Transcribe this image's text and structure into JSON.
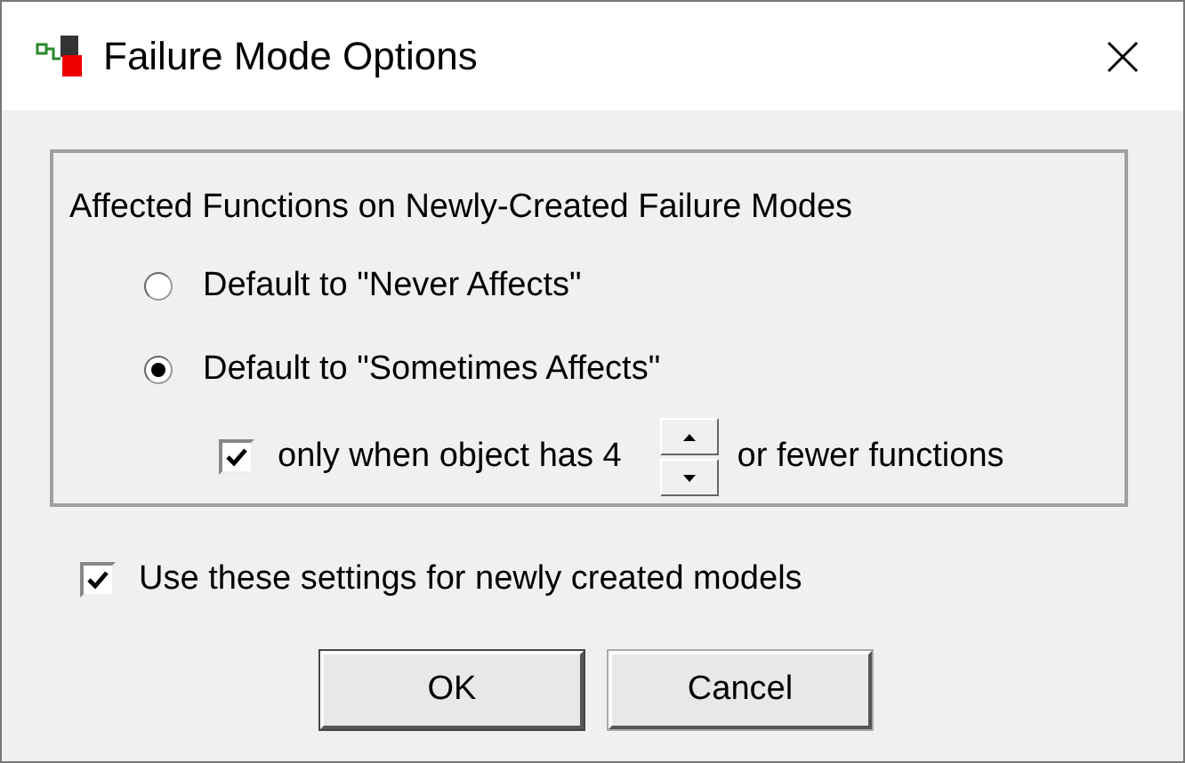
{
  "window": {
    "title": "Failure Mode Options"
  },
  "group": {
    "title": "Affected Functions on Newly-Created Failure Modes",
    "options": [
      {
        "label": "Default to \"Never Affects\"",
        "selected": false
      },
      {
        "label": "Default to \"Sometimes Affects\"",
        "selected": true
      }
    ],
    "limit": {
      "checked": true,
      "before": "only when object has 4",
      "after": "or fewer functions"
    }
  },
  "use_for_new_models": {
    "label": "Use these settings for newly created models",
    "checked": true
  },
  "buttons": [
    "OK",
    "Cancel"
  ]
}
